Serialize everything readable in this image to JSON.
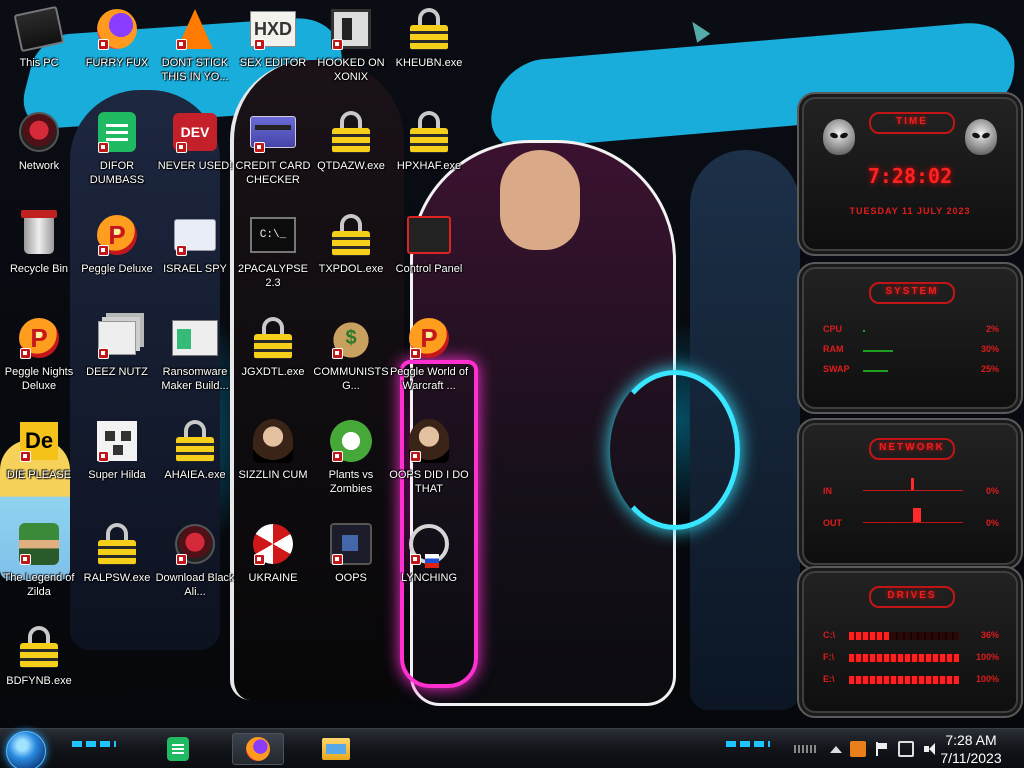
{
  "desktop": {
    "icons": [
      {
        "label": "This PC",
        "art": "pc-icon",
        "badge": false
      },
      {
        "label": "FURRY FUX",
        "art": "firefox-icon",
        "badge": true
      },
      {
        "label": "DONT STICK THIS IN YO...",
        "art": "vlc-cone-icon",
        "badge": true
      },
      {
        "label": "SEX EDITOR",
        "art": "hxd-icon",
        "badge": true
      },
      {
        "label": "HOOKED ON XONIX",
        "art": "xonix-icon",
        "badge": true
      },
      {
        "label": "KHEUBN.exe",
        "art": "lock-icon",
        "badge": false
      },
      {
        "label": "Network",
        "art": "alien-orb-icon",
        "badge": false
      },
      {
        "label": "DIFOR DUMBASS",
        "art": "sheets-icon",
        "badge": true
      },
      {
        "label": "NEVER USED!",
        "art": "dev-icon",
        "badge": true
      },
      {
        "label": "CREDIT CARD CHECKER",
        "art": "credit-card-icon",
        "badge": true
      },
      {
        "label": "QTDAZW.exe",
        "art": "lock-icon",
        "badge": false
      },
      {
        "label": "HPXHAF.exe",
        "art": "lock-icon",
        "badge": false
      },
      {
        "label": "Recycle Bin",
        "art": "recycle-bin-icon",
        "badge": false
      },
      {
        "label": "Peggle Deluxe",
        "art": "peggle-icon",
        "badge": true
      },
      {
        "label": "ISRAEL SPY",
        "art": "spy-window-icon",
        "badge": true
      },
      {
        "label": "2PACALYPSE 2.3",
        "art": "cmd-icon",
        "badge": false
      },
      {
        "label": "TXPDOL.exe",
        "art": "lock-icon",
        "badge": false
      },
      {
        "label": "Control Panel",
        "art": "control-panel-icon",
        "badge": false
      },
      {
        "label": "Peggle Nights Deluxe",
        "art": "peggle-icon",
        "badge": true
      },
      {
        "label": "DEEZ NUTZ",
        "art": "window-stack-icon",
        "badge": true
      },
      {
        "label": "Ransomware Maker Build...",
        "art": "app-window-icon",
        "badge": false
      },
      {
        "label": "JGXDTL.exe",
        "art": "lock-icon",
        "badge": false
      },
      {
        "label": "COMMUNISTS G...",
        "art": "money-bag-icon",
        "badge": true
      },
      {
        "label": "Peggle World of Warcraft ...",
        "art": "peggle-icon",
        "badge": true
      },
      {
        "label": "DIE PLEASE",
        "art": "die-icon",
        "badge": true
      },
      {
        "label": "Super Hilda",
        "art": "pixel-art-icon",
        "badge": true
      },
      {
        "label": "AHAIEA.exe",
        "art": "lock-icon",
        "badge": false
      },
      {
        "label": "SIZZLIN CUM",
        "art": "star-icon",
        "badge": false
      },
      {
        "label": "Plants vs Zombies",
        "art": "plants-icon",
        "badge": true
      },
      {
        "label": "OOPS DID I DO THAT",
        "art": "portrait-icon",
        "badge": true
      },
      {
        "label": "The Legend of Zilda",
        "art": "zelda-icon",
        "badge": true
      },
      {
        "label": "RALPSW.exe",
        "art": "lock-icon",
        "badge": false
      },
      {
        "label": "Download Black Ali...",
        "art": "alien-orb-icon",
        "badge": true
      },
      {
        "label": "UKRAINE",
        "art": "radiation-icon",
        "badge": true
      },
      {
        "label": "OOPS",
        "art": "oops-icon",
        "badge": true
      },
      {
        "label": "LYNCHING",
        "art": "rope-icon",
        "badge": true
      },
      {
        "label": "BDFYNB.exe",
        "art": "lock-icon",
        "badge": false
      }
    ]
  },
  "gadgets": {
    "clock": {
      "title": "TIME",
      "time": "7:28:02",
      "date": "TUESDAY 11 JULY 2023"
    },
    "system": {
      "title": "SYSTEM",
      "rows": [
        {
          "label": "CPU",
          "value": "2%",
          "level": 0.02
        },
        {
          "label": "RAM",
          "value": "30%",
          "level": 0.3
        },
        {
          "label": "SWAP",
          "value": "25%",
          "level": 0.25
        }
      ]
    },
    "network": {
      "title": "NETWORK",
      "rows": [
        {
          "label": "IN",
          "value": "0%"
        },
        {
          "label": "OUT",
          "value": "0%"
        }
      ]
    },
    "drives": {
      "title": "DRIVES",
      "rows": [
        {
          "label": "C:\\",
          "value": "36%",
          "level": 0.36
        },
        {
          "label": "F:\\",
          "value": "100%",
          "level": 1.0
        },
        {
          "label": "E:\\",
          "value": "100%",
          "level": 1.0
        }
      ]
    }
  },
  "taskbar": {
    "start_icon": "start-orb-icon",
    "pinned": [
      {
        "name": "sheets",
        "icon": "sheets-icon",
        "active": false
      },
      {
        "name": "firefox",
        "icon": "firefox-icon",
        "active": true
      },
      {
        "name": "file-explorer",
        "icon": "folder-icon",
        "active": false
      }
    ],
    "tray_icons": [
      "chevron-up-icon",
      "app-icon",
      "flag-icon",
      "network-icon",
      "volume-icon"
    ],
    "clock": {
      "time": "7:28 AM",
      "date": "7/11/2023"
    }
  },
  "colors": {
    "accent_red": "#e01b1b",
    "accent_cyan": "#1fc3ff",
    "lock_yellow": "#f6cf1a"
  }
}
